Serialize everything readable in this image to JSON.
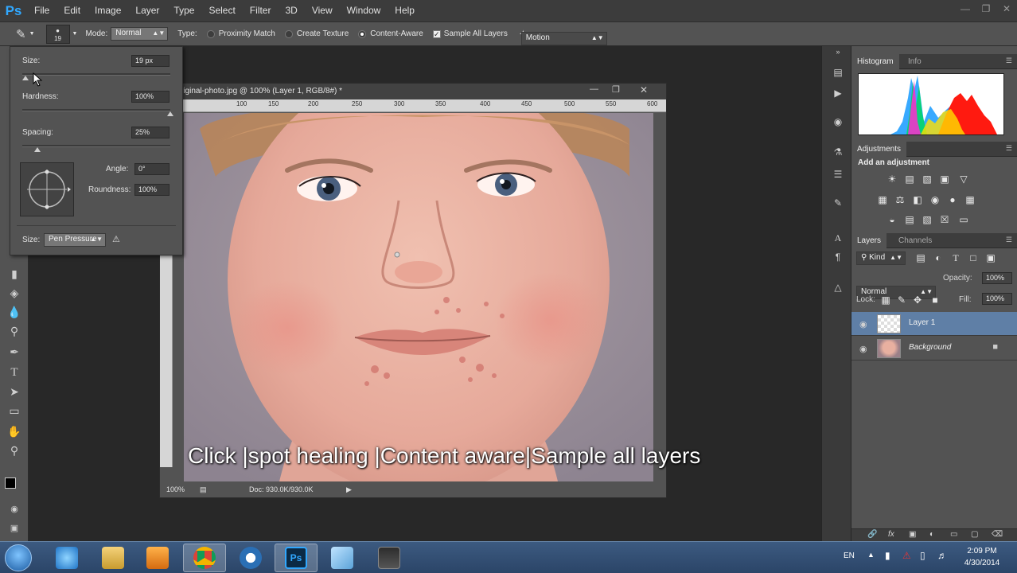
{
  "app": {
    "logo": "Ps"
  },
  "menu": [
    "File",
    "Edit",
    "Image",
    "Layer",
    "Type",
    "Select",
    "Filter",
    "3D",
    "View",
    "Window",
    "Help"
  ],
  "options": {
    "brush_size": "19",
    "mode_label": "Mode:",
    "mode_value": "Normal",
    "type_label": "Type:",
    "type_options": [
      "Proximity Match",
      "Create Texture",
      "Content-Aware"
    ],
    "selected_type": "Content-Aware",
    "sample_all_layers": "Sample All Layers",
    "sample_all_checked": true,
    "workspace": "Motion"
  },
  "brush_popup": {
    "size_label": "Size:",
    "size_value": "19 px",
    "hardness_label": "Hardness:",
    "hardness_value": "100%",
    "spacing_label": "Spacing:",
    "spacing_value": "25%",
    "angle_label": "Angle:",
    "angle_value": "0°",
    "roundness_label": "Roundness:",
    "roundness_value": "100%",
    "pressure_label": "Size:",
    "pressure_value": "Pen Pressure",
    "size_level": 0.02,
    "hardness_level": 1.0,
    "spacing_level": 0.1
  },
  "document": {
    "title": "riginal-photo.jpg @ 100% (Layer 1, RGB/8#) *",
    "ruler_ticks": [
      "100",
      "150",
      "200",
      "250",
      "300",
      "350",
      "400",
      "450",
      "500",
      "550",
      "600"
    ],
    "zoom": "100%",
    "doc_size": "Doc: 930.0K/930.0K"
  },
  "caption": "Click |spot healing |Content aware|Sample all layers",
  "panels": {
    "histogram_tab": "Histogram",
    "info_tab": "Info",
    "adjustments_tab": "Adjustments",
    "add_adjustment": "Add an adjustment",
    "layers_tab": "Layers",
    "channels_tab": "Channels",
    "kind_label": "Kind",
    "blend_mode": "Normal",
    "opacity_label": "Opacity:",
    "opacity_value": "100%",
    "lock_label": "Lock:",
    "fill_label": "Fill:",
    "fill_value": "100%",
    "layers": [
      {
        "name": "Layer 1",
        "selected": true
      },
      {
        "name": "Background",
        "selected": false
      }
    ]
  },
  "taskbar": {
    "language": "EN",
    "time": "2:09 PM",
    "date": "4/30/2014"
  },
  "colors": {
    "accent": "#31a8ff",
    "selected_layer": "#5f7fa6"
  }
}
